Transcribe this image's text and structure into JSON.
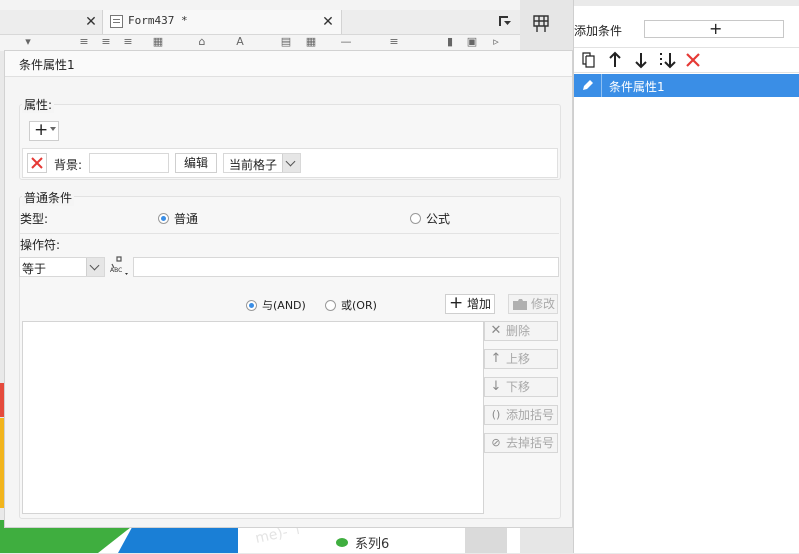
{
  "editor": {
    "tab_title": "Form437 *",
    "canvas_legend": "系列6",
    "canvas_watermark": "me)- ↑"
  },
  "right_panel": {
    "add_condition_label": "添加条件",
    "add_button_icon": "plus-icon",
    "toolbar": [
      "copy-icon",
      "arrow-up-icon",
      "arrow-down-icon",
      "move-bottom-icon",
      "delete-icon"
    ],
    "items": [
      {
        "label": "条件属性1",
        "icon": "pencil-icon",
        "selected": true
      }
    ],
    "accent_color": "#3a8ee6"
  },
  "dialog": {
    "title": "条件属性1",
    "attributes_group": {
      "label": "属性:",
      "add_icon": "plus-icon",
      "property": {
        "name": "背景:",
        "value": "",
        "edit_label": "编辑",
        "scope_value": "当前格子"
      }
    },
    "general_group": {
      "label": "普通条件",
      "type_label": "类型:",
      "type_options": [
        {
          "label": "普通",
          "checked": true
        },
        {
          "label": "公式",
          "checked": false
        }
      ],
      "operator_label": "操作符:",
      "operator_value": "等于",
      "operand_value": "",
      "logic_options": [
        {
          "label": "与(AND)",
          "checked": true
        },
        {
          "label": "或(OR)",
          "checked": false
        }
      ],
      "add_label": "增加",
      "modify_label": "修改",
      "side_buttons": [
        {
          "label": "删除",
          "icon": "x-icon"
        },
        {
          "label": "上移",
          "icon": "arrow-up-icon"
        },
        {
          "label": "下移",
          "icon": "arrow-down-icon"
        },
        {
          "label": "添加括号",
          "icon": "parentheses-icon"
        },
        {
          "label": "去掉括号",
          "icon": "remove-parentheses-icon"
        }
      ]
    }
  }
}
